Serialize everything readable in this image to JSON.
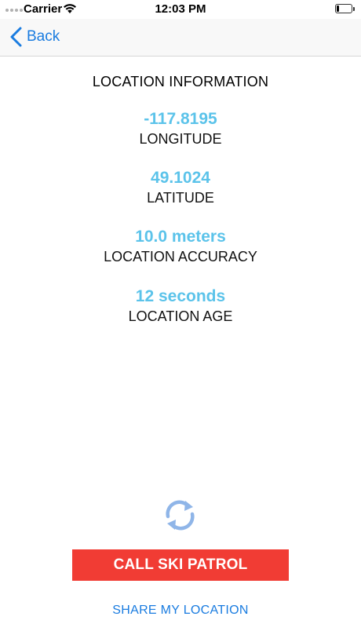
{
  "status_bar": {
    "carrier": "Carrier",
    "time": "12:03 PM",
    "icons": [
      "signal-dots-icon",
      "wifi-icon",
      "battery-icon"
    ],
    "battery_level": 0.15
  },
  "nav": {
    "back_label": "Back",
    "back_icon": "chevron-left-icon"
  },
  "location": {
    "title": "LOCATION INFORMATION",
    "items": [
      {
        "value": "-117.8195",
        "label": "LONGITUDE"
      },
      {
        "value": "49.1024",
        "label": "LATITUDE"
      },
      {
        "value": "10.0 meters",
        "label": "LOCATION ACCURACY"
      },
      {
        "value": "12 seconds",
        "label": "LOCATION AGE"
      }
    ]
  },
  "actions": {
    "refresh_icon": "refresh-icon",
    "call_label": "CALL SKI PATROL",
    "share_label": "SHARE MY LOCATION"
  },
  "colors": {
    "accent_blue": "#1a7ce0",
    "value_blue": "#5bc3ea",
    "call_red": "#f13c34",
    "refresh_blue": "#8fb5e8"
  }
}
